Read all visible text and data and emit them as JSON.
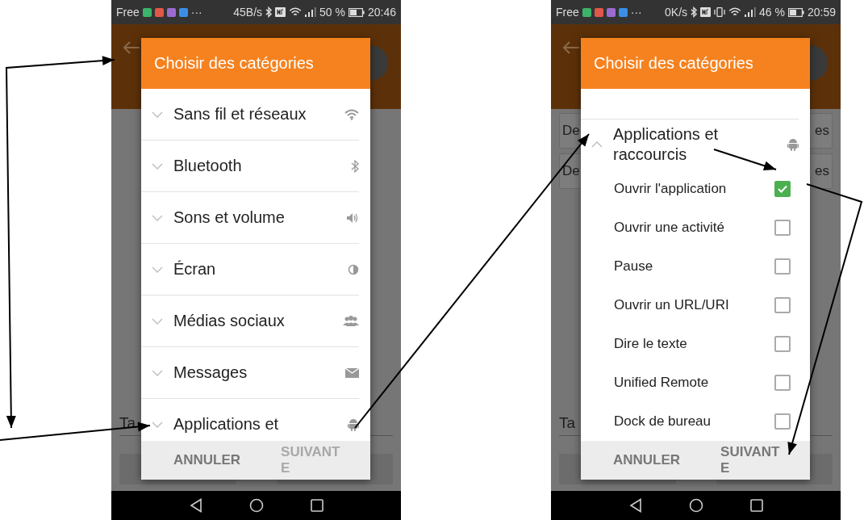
{
  "phones": [
    {
      "status_bar": {
        "carrier": "Free",
        "overflow": "···",
        "speed": "45B/s",
        "vibrate": false,
        "battery": "50 %",
        "time": "20:46"
      },
      "background": {
        "field": "Ta"
      },
      "dialog": {
        "title": "Choisir des catégories",
        "items": [
          {
            "kind": "category",
            "label": "Sans fil et réseaux",
            "expanded": false
          },
          {
            "kind": "category",
            "label": "Bluetooth",
            "expanded": false
          },
          {
            "kind": "category",
            "label": "Sons et volume",
            "expanded": false
          },
          {
            "kind": "category",
            "label": "Écran",
            "expanded": false
          },
          {
            "kind": "category",
            "label": "Médias sociaux",
            "expanded": false
          },
          {
            "kind": "category",
            "label": "Messages",
            "expanded": false
          },
          {
            "kind": "category",
            "label": "Applications et",
            "expanded": false
          }
        ],
        "cancel": "ANNULER",
        "next": {
          "label": "SUIVANTE",
          "disabled": true
        }
      }
    },
    {
      "status_bar": {
        "carrier": "Free",
        "overflow": "···",
        "speed": "0K/s",
        "vibrate": true,
        "battery": "46 %",
        "time": "20:59"
      },
      "background": {
        "cards": [
          {
            "left": "De",
            "right": "es"
          },
          {
            "left": "De",
            "right": "es"
          }
        ],
        "field": "Ta"
      },
      "dialog": {
        "title": "Choisir des catégories",
        "items": [
          {
            "kind": "category",
            "label": "Applications et raccourcis",
            "expanded": true
          },
          {
            "kind": "option",
            "label": "Ouvrir l'application",
            "checked": true
          },
          {
            "kind": "option",
            "label": "Ouvrir une activité",
            "checked": false
          },
          {
            "kind": "option",
            "label": "Pause",
            "checked": false
          },
          {
            "kind": "option",
            "label": "Ouvrir un URL/URI",
            "checked": false
          },
          {
            "kind": "option",
            "label": "Dire le texte",
            "checked": false
          },
          {
            "kind": "option",
            "label": "Unified Remote",
            "checked": false
          },
          {
            "kind": "option",
            "label": "Dock de bureau",
            "checked": false
          }
        ],
        "cancel": "ANNULER",
        "next": {
          "label": "SUIVANTE",
          "disabled": false
        }
      }
    }
  ]
}
